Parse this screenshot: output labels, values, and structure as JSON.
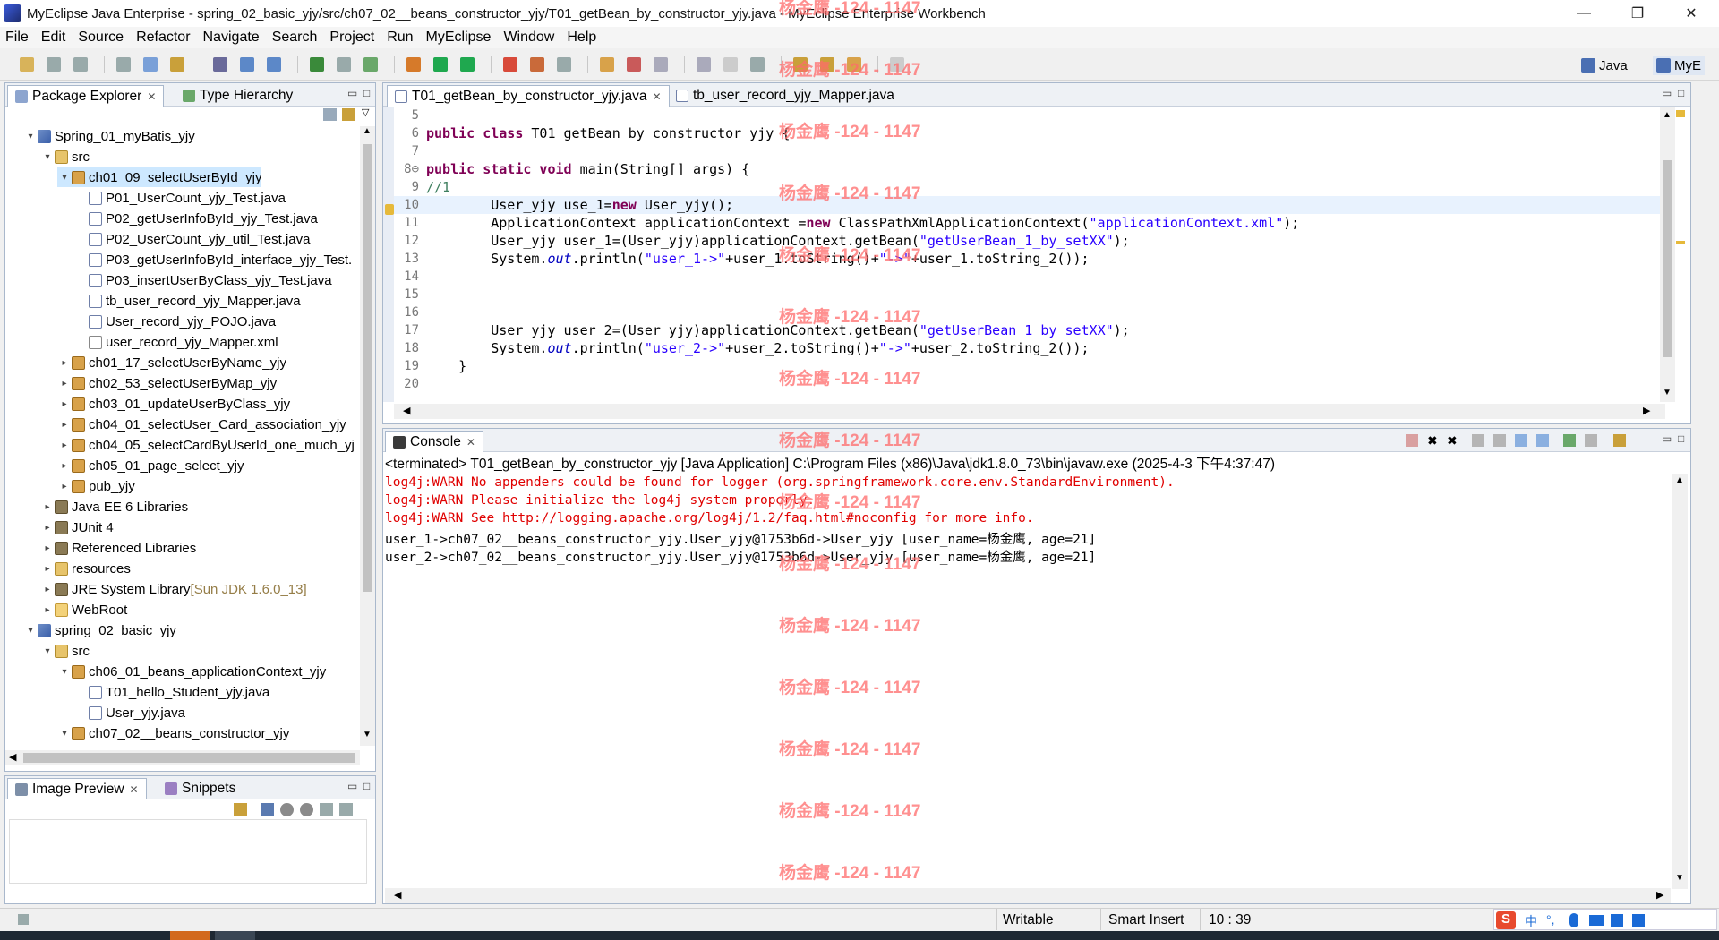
{
  "window": {
    "title": "MyEclipse Java Enterprise - spring_02_basic_yjy/src/ch07_02__beans_constructor_yjy/T01_getBean_by_constructor_yjy.java - MyEclipse Enterprise Workbench",
    "minimize": "—",
    "restore": "❐",
    "close": "✕"
  },
  "menu": [
    "File",
    "Edit",
    "Source",
    "Refactor",
    "Navigate",
    "Search",
    "Project",
    "Run",
    "MyEclipse",
    "Window",
    "Help"
  ],
  "perspectives": {
    "java": "Java",
    "myeclipse": "MyE"
  },
  "package_explorer": {
    "tab_label": "Package Explorer",
    "tab2_label": "Type Hierarchy",
    "rows": [
      {
        "text": "Spring_01_myBatis_yjy",
        "icon": "proj",
        "level": 0,
        "twisty": "▾"
      },
      {
        "text": "src",
        "icon": "src",
        "level": 1,
        "twisty": "▾"
      },
      {
        "text": "ch01_09_selectUserById_yjy",
        "icon": "pkg",
        "level": 2,
        "twisty": "▾",
        "selected": true
      },
      {
        "text": "P01_UserCount_yjy_Test.java",
        "icon": "java",
        "level": 3
      },
      {
        "text": "P02_getUserInfoById_yjy_Test.java",
        "icon": "java",
        "level": 3
      },
      {
        "text": "P02_UserCount_yjy_util_Test.java",
        "icon": "java",
        "level": 3
      },
      {
        "text": "P03_getUserInfoById_interface_yjy_Test.",
        "icon": "java",
        "level": 3
      },
      {
        "text": "P03_insertUserByClass_yjy_Test.java",
        "icon": "java",
        "level": 3
      },
      {
        "text": "tb_user_record_yjy_Mapper.java",
        "icon": "java",
        "level": 3
      },
      {
        "text": "User_record_yjy_POJO.java",
        "icon": "java",
        "level": 3
      },
      {
        "text": "user_record_yjy_Mapper.xml",
        "icon": "xml",
        "level": 3
      },
      {
        "text": "ch01_17_selectUserByName_yjy",
        "icon": "pkg",
        "level": 2,
        "twisty": "▸"
      },
      {
        "text": "ch02_53_selectUserByMap_yjy",
        "icon": "pkg",
        "level": 2,
        "twisty": "▸"
      },
      {
        "text": "ch03_01_updateUserByClass_yjy",
        "icon": "pkg",
        "level": 2,
        "twisty": "▸"
      },
      {
        "text": "ch04_01_selectUser_Card_association_yjy",
        "icon": "pkg",
        "level": 2,
        "twisty": "▸"
      },
      {
        "text": "ch04_05_selectCardByUserId_one_much_yj",
        "icon": "pkg",
        "level": 2,
        "twisty": "▸"
      },
      {
        "text": "ch05_01_page_select_yjy",
        "icon": "pkg",
        "level": 2,
        "twisty": "▸"
      },
      {
        "text": "pub_yjy",
        "icon": "pkg",
        "level": 2,
        "twisty": "▸"
      },
      {
        "text": "Java EE 6 Libraries",
        "icon": "lib",
        "level": 1,
        "twisty": "▸"
      },
      {
        "text": "JUnit 4",
        "icon": "lib",
        "level": 1,
        "twisty": "▸"
      },
      {
        "text": "Referenced Libraries",
        "icon": "lib",
        "level": 1,
        "twisty": "▸"
      },
      {
        "text": "resources",
        "icon": "src",
        "level": 1,
        "twisty": "▸"
      },
      {
        "text": "JRE System Library",
        "suffix": "[Sun JDK 1.6.0_13]",
        "icon": "lib",
        "level": 1,
        "twisty": "▸"
      },
      {
        "text": "WebRoot",
        "icon": "folder",
        "level": 1,
        "twisty": "▸"
      },
      {
        "text": "spring_02_basic_yjy",
        "icon": "proj",
        "level": 0,
        "twisty": "▾"
      },
      {
        "text": "src",
        "icon": "src",
        "level": 1,
        "twisty": "▾"
      },
      {
        "text": "ch06_01_beans_applicationContext_yjy",
        "icon": "pkg",
        "level": 2,
        "twisty": "▾"
      },
      {
        "text": "T01_hello_Student_yjy.java",
        "icon": "java",
        "level": 3
      },
      {
        "text": "User_yjy.java",
        "icon": "java",
        "level": 3
      },
      {
        "text": "ch07_02__beans_constructor_yjy",
        "icon": "pkg",
        "level": 2,
        "twisty": "▾"
      }
    ]
  },
  "image_preview": {
    "tab_label": "Image Preview",
    "tab2_label": "Snippets"
  },
  "editor": {
    "tabs": [
      {
        "label": "T01_getBean_by_constructor_yjy.java",
        "active": true
      },
      {
        "label": "tb_user_record_yjy_Mapper.java",
        "active": false
      }
    ],
    "lines": [
      {
        "n": "5",
        "html": ""
      },
      {
        "n": "6",
        "html": "<span class=\"kw\">public class</span> T01_getBean_by_constructor_yjy {"
      },
      {
        "n": "7",
        "html": ""
      },
      {
        "n": "8⊖",
        "html": "    <span class=\"kw\">public static void</span> main(String[] args) {"
      },
      {
        "n": "9",
        "html": "        <span class=\"cmt\">//1</span>"
      },
      {
        "n": "10",
        "html": "        User_yjy use_1=<span class=\"kw\">new</span> User_yjy();",
        "current": true
      },
      {
        "n": "11",
        "html": "        ApplicationContext applicationContext =<span class=\"kw\">new</span> ClassPathXmlApplicationContext(<span class=\"str\">\"applicationContext.xml\"</span>);"
      },
      {
        "n": "12",
        "html": "        User_yjy user_1=(User_yjy)applicationContext.getBean(<span class=\"str\">\"getUserBean_1_by_setXX\"</span>);"
      },
      {
        "n": "13",
        "html": "        System.<span class=\"it\">out</span>.println(<span class=\"str\">\"user_1-&gt;\"</span>+user_1.toString()+<span class=\"str\">\"-&gt;\"</span>+user_1.toString_2());"
      },
      {
        "n": "14",
        "html": ""
      },
      {
        "n": "15",
        "html": ""
      },
      {
        "n": "16",
        "html": ""
      },
      {
        "n": "17",
        "html": "        User_yjy user_2=(User_yjy)applicationContext.getBean(<span class=\"str\">\"getUserBean_1_by_setXX\"</span>);"
      },
      {
        "n": "18",
        "html": "        System.<span class=\"it\">out</span>.println(<span class=\"str\">\"user_2-&gt;\"</span>+user_2.toString()+<span class=\"str\">\"-&gt;\"</span>+user_2.toString_2());"
      },
      {
        "n": "19",
        "html": "    }"
      },
      {
        "n": "20",
        "html": ""
      }
    ]
  },
  "console": {
    "tab_label": "Console",
    "header": "<terminated> T01_getBean_by_constructor_yjy [Java Application] C:\\Program Files (x86)\\Java\\jdk1.8.0_73\\bin\\javaw.exe (2025-4-3 下午4:37:47)",
    "lines": [
      {
        "text": "log4j:WARN No appenders could be found for logger (org.springframework.core.env.StandardEnvironment).",
        "warn": true
      },
      {
        "text": "log4j:WARN Please initialize the log4j system properly.",
        "warn": true
      },
      {
        "text": "log4j:WARN See http://logging.apache.org/log4j/1.2/faq.html#noconfig for more info.",
        "warn": true
      },
      {
        "text": "user_1->ch07_02__beans_constructor_yjy.User_yjy@1753b6d->User_yjy [user_name=杨金鹰, age=21]",
        "warn": false
      },
      {
        "text": "user_2->ch07_02__beans_constructor_yjy.User_yjy@1753b6d->User_yjy [user_name=杨金鹰, age=21]",
        "warn": false
      }
    ]
  },
  "status": {
    "writable": "Writable",
    "insert_mode": "Smart Insert",
    "position": "10 : 39"
  },
  "watermark": "杨金鹰 -124 - 1147",
  "colors": {
    "selection": "#cde8ff",
    "warn": "#e00000",
    "keyword": "#7f0055",
    "string": "#2a00ff"
  }
}
